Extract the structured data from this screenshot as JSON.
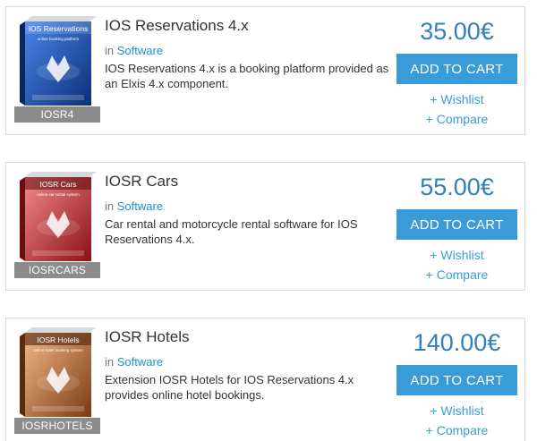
{
  "products": [
    {
      "title": "IOS Reservations 4.x",
      "category_prefix": "in",
      "category": "Software",
      "description": "IOS Reservations 4.x is a booking platform provided as an Elxis 4.x component.",
      "sku": "IOSR4",
      "price": "35.00€",
      "cart_label": "ADD TO CART",
      "wishlist_label": "+ Wishlist",
      "compare_label": "+ Compare",
      "box_title": "IOS Reservations",
      "box_subtitle": "online booking platform",
      "box_color": "#1d4fb0",
      "icon": "product-box-icon"
    },
    {
      "title": "IOSR Cars",
      "category_prefix": "in",
      "category": "Software",
      "description": "Car rental and motorcycle rental software for IOS Reservations 4.x.",
      "sku": "IOSRCARS",
      "price": "55.00€",
      "cart_label": "ADD TO CART",
      "wishlist_label": "+ Wishlist",
      "compare_label": "+ Compare",
      "box_title": "IOSR Cars",
      "box_subtitle": "online car rental system",
      "box_color": "#b5222b",
      "icon": "product-box-icon"
    },
    {
      "title": "IOSR Hotels",
      "category_prefix": "in",
      "category": "Software",
      "description": "Extension IOSR Hotels for IOS Reservations 4.x provides online hotel bookings.",
      "sku": "IOSRHOTELS",
      "price": "140.00€",
      "cart_label": "ADD TO CART",
      "wishlist_label": "+ Wishlist",
      "compare_label": "+ Compare",
      "box_title": "IOSR Hotels",
      "box_subtitle": "online hotel booking system",
      "box_color": "#a8561e",
      "icon": "product-box-icon"
    }
  ],
  "colors": {
    "accent": "#3a9bd9",
    "price": "#2f7fc1",
    "sku_bg": "#8c8c8c"
  }
}
